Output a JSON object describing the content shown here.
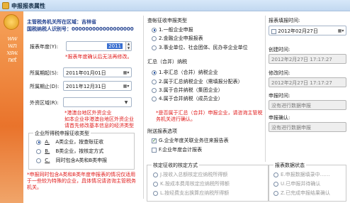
{
  "window": {
    "title": "申报报表属性"
  },
  "banner": {
    "text": "www.nxsw.net"
  },
  "left": {
    "district": "主管税务机关所在区域：吉林省",
    "taxpayer_id": "国税纳税人识别号：000000000000000000",
    "year_label": "报表年度(Y):",
    "year_value": "2011",
    "year_note": "*报表年度确认后无法再修改。",
    "start_label": "所属期起(S):",
    "start_value": "2011年01月01日",
    "end_label": "所属期止(D):",
    "end_value": "2011年12月31日",
    "region_label": "外资区域(R):",
    "region_value": "",
    "region_note": "*港澳台地区外资企业\n如本企业非港澳台地区外资企业\n请首先修改基本信息的经济类型",
    "income_group_title": "企业所得税申报征收类型",
    "income_options": [
      {
        "key": "A.",
        "label": "A类企业，按查账征收",
        "selected": true
      },
      {
        "key": "B.",
        "label": "B类企业，按核定方式",
        "selected": false
      },
      {
        "key": "C.",
        "label": "同时包含A类和B类申报",
        "selected": false
      }
    ],
    "bottom_note": "*申报同时包含A类和B类年度申报表的情况仅适用于一些较为特殊的企业，具体情况请咨询主管税务机关。"
  },
  "middle": {
    "type_title": "查帐征收申报类型",
    "type_options": [
      {
        "label": "1.一般企业申报",
        "selected": true
      },
      {
        "label": "2.金融企业申报报表",
        "selected": false
      },
      {
        "label": "3.事业单位、社会团体、民办非企业单位",
        "selected": false
      }
    ],
    "summary_title": "汇总（合并）纳税",
    "summary_options": [
      {
        "label": "1.非汇总（合并）纳税企业",
        "selected": true
      },
      {
        "label": "2.属于汇总纳税企业（需填报分配表）",
        "selected": false
      },
      {
        "label": "3.属于合并纳税（集团企业）",
        "selected": false
      },
      {
        "label": "4.属于合并纳税（成员企业）",
        "selected": false
      }
    ],
    "summary_note": "*是否属于汇总（合并）申报企业，请咨询主管税务机关进行确认。",
    "attach_title": "附送报表选项",
    "attach_options": [
      {
        "label": "G.企业年度关联业务往来报告表",
        "checked": true
      },
      {
        "label": "F.企业年度会计报表",
        "checked": false
      }
    ],
    "verify_title": "核定征收的核定方式",
    "verify_options": [
      {
        "label": "J.按收入总额核定应纳税所得额"
      },
      {
        "label": "K.按成本费用核定应纳税所得额"
      },
      {
        "label": "L.按经费支出换算应纳税所得额"
      }
    ]
  },
  "right": {
    "fill_date_label": "报表填报时间:",
    "fill_date_value": "2012年02月27日",
    "create_label": "创建时间:",
    "create_value": "2012年2月27日 17:17:27",
    "modify_label": "修改时间:",
    "modify_value": "2012年2月27日 17:17:27",
    "declare_label": "申报时间:",
    "declare_value": "没有进行数据申报",
    "confirm_label": "申报确认:",
    "confirm_value": "没有进行数据申报",
    "status_title": "报表数据状态",
    "status_options": [
      {
        "label": "E.申报数据填录中……"
      },
      {
        "label": "U.已申报并待确认"
      },
      {
        "label": "Z.已完成申报结果确认"
      }
    ]
  }
}
